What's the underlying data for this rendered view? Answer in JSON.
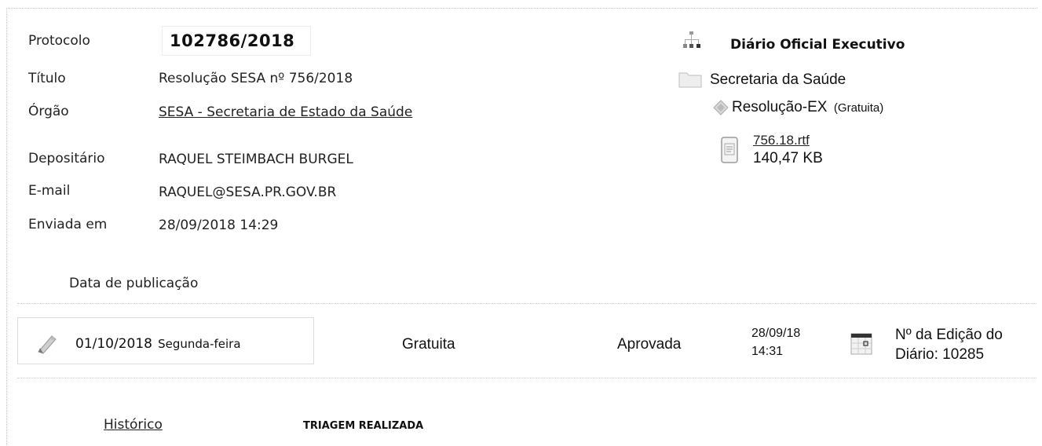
{
  "record": {
    "protocolo_label": "Protocolo",
    "protocolo_value": "102786/2018",
    "titulo_label": "Título",
    "titulo_value": "Resolução SESA nº 756/2018",
    "orgao_label": "Órgão",
    "orgao_value": "SESA - Secretaria de Estado da Saúde",
    "depositario_label": "Depositário",
    "depositario_value": "RAQUEL STEIMBACH BURGEL",
    "email_label": "E-mail",
    "email_value": "RAQUEL@SESA.PR.GOV.BR",
    "enviada_label": "Enviada em",
    "enviada_value": "28/09/2018 14:29"
  },
  "tree": {
    "root_label": "Diário Oficial Executivo",
    "folder_label": "Secretaria da Saúde",
    "type_label": "Resolução-EX",
    "type_note": "(Gratuita)",
    "file_name": "756.18.rtf",
    "file_size": "140,47 KB",
    "icons": [
      "sitemap-icon",
      "folder-icon",
      "diamond-icon",
      "document-icon"
    ]
  },
  "publication": {
    "section_label": "Data de publicação",
    "date": "01/10/2018",
    "weekday": "Segunda-feira",
    "cost": "Gratuita",
    "status": "Aprovada",
    "approved_date": "28/09/18",
    "approved_time": "14:31",
    "edition_line1": "Nº da Edição do",
    "edition_line2": "Diário: 10285",
    "icons": [
      "pen-icon",
      "calendar-icon"
    ]
  },
  "footer": {
    "historico_link": "Histórico",
    "status_text": "TRIAGEM REALIZADA"
  }
}
